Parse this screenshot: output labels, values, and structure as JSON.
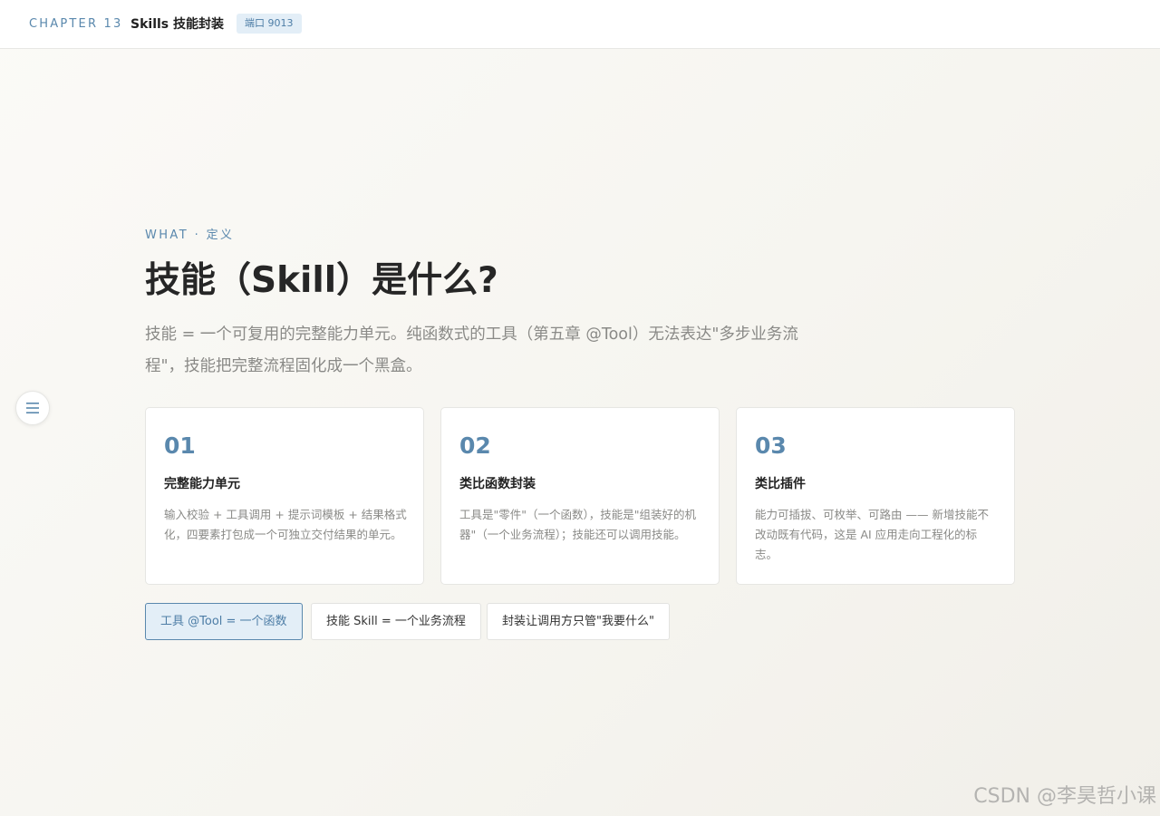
{
  "header": {
    "chapter": "CHAPTER 13",
    "title": "Skills 技能封装",
    "port_badge": "端口 9013"
  },
  "sidebar_toggle": {
    "icon": "menu-icon"
  },
  "main": {
    "eyebrow": "WHAT · 定义",
    "headline": "技能（Skill）是什么?",
    "lead": "技能 = 一个可复用的完整能力单元。纯函数式的工具（第五章 @Tool）无法表达\"多步业务流程\"，技能把完整流程固化成一个黑盒。",
    "cards": [
      {
        "num": "01",
        "title": "完整能力单元",
        "desc": "输入校验 + 工具调用 + 提示词模板 + 结果格式化，四要素打包成一个可独立交付结果的单元。"
      },
      {
        "num": "02",
        "title": "类比函数封装",
        "desc": "工具是\"零件\"（一个函数），技能是\"组装好的机器\"（一个业务流程）；技能还可以调用技能。"
      },
      {
        "num": "03",
        "title": "类比插件",
        "desc": "能力可插拔、可枚举、可路由 —— 新增技能不改动既有代码，这是 AI 应用走向工程化的标志。"
      }
    ],
    "pills": [
      {
        "label": "工具 @Tool = 一个函数",
        "active": true
      },
      {
        "label": "技能 Skill = 一个业务流程",
        "active": false
      },
      {
        "label": "封装让调用方只管\"我要什么\"",
        "active": false
      }
    ]
  },
  "watermark": "CSDN @李昊哲小课",
  "colors": {
    "accent": "#5a88ad",
    "badge_bg": "#e3eef7",
    "text_primary": "#262626",
    "text_muted": "#8a8a87"
  }
}
